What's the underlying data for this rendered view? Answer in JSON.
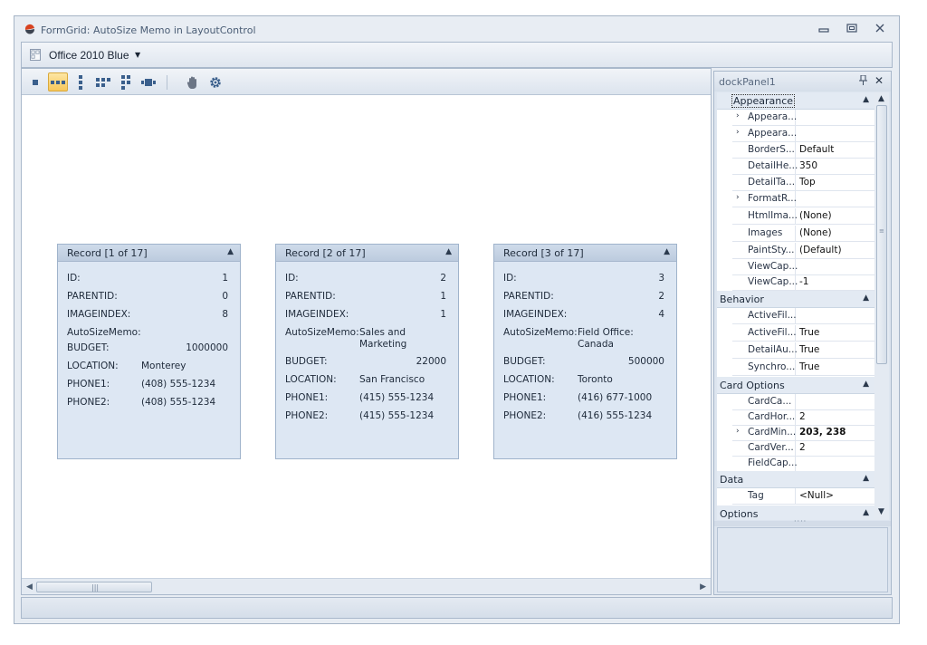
{
  "window": {
    "title": "FormGrid: AutoSize Memo in LayoutControl",
    "controls": {
      "minimize": "—",
      "restore": "▢",
      "close": "✕"
    }
  },
  "skin": {
    "label": "Office 2010 Blue"
  },
  "toolbar": {
    "buttons": [
      "single-record-view-icon",
      "row-view-icon",
      "column-view-icon",
      "multi-row-view-icon",
      "multi-column-view-icon",
      "carousel-view-icon",
      "pan-hand-icon",
      "customize-gear-icon"
    ],
    "active_index": 1
  },
  "cards": [
    {
      "title": "Record [1 of 17]",
      "id": "1",
      "parentid": "0",
      "imageindex": "8",
      "autosizememo": "",
      "budget": "1000000",
      "location": "Monterey",
      "phone1": "(408) 555-1234",
      "phone2": "(408) 555-1234"
    },
    {
      "title": "Record [2 of 17]",
      "id": "2",
      "parentid": "1",
      "imageindex": "1",
      "autosizememo_line1": "Sales and",
      "autosizememo_line2": "Marketing",
      "budget": "22000",
      "location": "San Francisco",
      "phone1": "(415) 555-1234",
      "phone2": "(415) 555-1234"
    },
    {
      "title": "Record [3 of 17]",
      "id": "3",
      "parentid": "2",
      "imageindex": "4",
      "autosizememo_line1": "Field Office:",
      "autosizememo_line2": "Canada",
      "budget": "500000",
      "location": "Toronto",
      "phone1": "(416) 677-1000",
      "phone2": "(416) 555-1234"
    }
  ],
  "field_labels": {
    "id": "ID:",
    "parentid": "PARENTID:",
    "imageindex": "IMAGEINDEX:",
    "autosizememo": "AutoSizeMemo:",
    "budget": "BUDGET:",
    "location": "LOCATION:",
    "phone1": "PHONE1:",
    "phone2": "PHONE2:"
  },
  "dock": {
    "title": "dockPanel1",
    "categories": {
      "appearance": "Appearance",
      "behavior": "Behavior",
      "card_options": "Card Options",
      "data": "Data",
      "options": "Options"
    },
    "appearance_rows": [
      {
        "name": "Appeara...",
        "value": "",
        "expandable": true
      },
      {
        "name": "Appeara...",
        "value": "",
        "expandable": true
      },
      {
        "name": "BorderS...",
        "value": "Default"
      },
      {
        "name": "DetailHe...",
        "value": "350"
      },
      {
        "name": "DetailTa...",
        "value": "Top"
      },
      {
        "name": "FormatR...",
        "value": "",
        "expandable": true
      },
      {
        "name": "HtmlIma...",
        "value": "(None)"
      },
      {
        "name": "Images",
        "value": "(None)"
      },
      {
        "name": "PaintSty...",
        "value": "(Default)"
      },
      {
        "name": "ViewCap...",
        "value": ""
      },
      {
        "name": "ViewCap...",
        "value": "-1"
      }
    ],
    "behavior_rows": [
      {
        "name": "ActiveFil...",
        "value": ""
      },
      {
        "name": "ActiveFil...",
        "value": "True"
      },
      {
        "name": "DetailAu...",
        "value": "True"
      },
      {
        "name": "Synchro...",
        "value": "True"
      }
    ],
    "card_options_rows": [
      {
        "name": "CardCa...",
        "value": ""
      },
      {
        "name": "CardHor...",
        "value": "2"
      },
      {
        "name": "CardMin...",
        "value": "203, 238",
        "expandable": true,
        "bold": true
      },
      {
        "name": "CardVer...",
        "value": "2"
      },
      {
        "name": "FieldCap...",
        "value": ""
      }
    ],
    "data_rows": [
      {
        "name": "Tag",
        "value": "<Null>"
      }
    ]
  },
  "colors": {
    "accent_active": "#f7c75a",
    "card_bg": "#dde7f3",
    "card_header": "#bccbde"
  }
}
